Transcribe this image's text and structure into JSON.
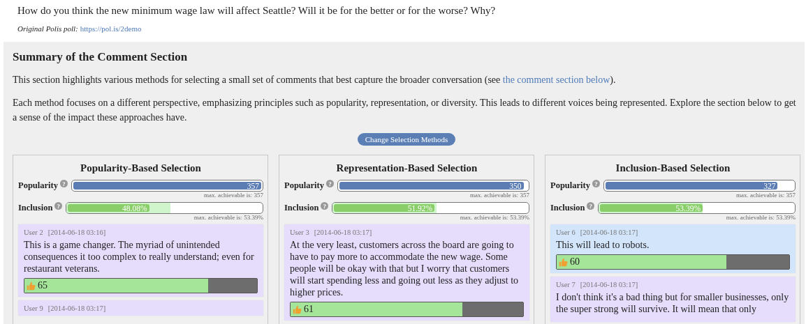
{
  "question": "How do you think the new minimum wage law will affect Seattle? Will it be for the better or for the worse? Why?",
  "poll": {
    "label": "Original Polis poll:",
    "link": "https://pol.is/2demo"
  },
  "summary": {
    "title": "Summary of the Comment Section",
    "intro": "This section highlights various methods for selecting a small set of comments that best capture the broader conversation (see ",
    "intro_link": "the comment section below",
    "intro_end": ").",
    "description": "Each method focuses on a different perspective, emphasizing principles such as popularity, representation, or diversity. This leads to different voices being represented. Explore the section below to get a sense of the impact these approaches have.",
    "button": "Change Selection Methods",
    "methods": [
      {
        "title": "Popularity-Based Selection",
        "metrics": [
          {
            "kind": "popularity",
            "label": "Popularity",
            "help": "?",
            "value": "357",
            "level": 1,
            "max_note": "max. achievable is: 357"
          },
          {
            "kind": "inclusion",
            "label": "Inclusion",
            "help": "?",
            "value": "48.08%",
            "level": 0.42,
            "max": {
              "level": 0.53
            },
            "max_note": "max. achievable is: 53.39%"
          }
        ],
        "comments": [
          {
            "user": "User 2",
            "time": "[2014-06-18 03:16]",
            "text": "This is a game changer. The myriad of unintended consequences it too complex to really understand; even for restaurant veterans.",
            "votes": "65",
            "level": 0.79,
            "color": "#e6dcfc"
          },
          {
            "user": "User 9",
            "time": "[2014-06-18 03:17]",
            "color": "#e6dcfc"
          }
        ]
      },
      {
        "title": "Representation-Based Selection",
        "metrics": [
          {
            "kind": "popularity",
            "label": "Popularity",
            "help": "?",
            "value": "350",
            "level": 0.98,
            "max_note": "max. achievable is: 357"
          },
          {
            "kind": "inclusion",
            "label": "Inclusion",
            "help": "?",
            "value": "51.92%",
            "level": 0.52,
            "max": {
              "level": 0.53
            },
            "max_note": "max. achievable is: 53.39%"
          }
        ],
        "comments": [
          {
            "user": "User 3",
            "time": "[2014-06-18 03:17]",
            "text": "At the very least, customers across the board are going to have to pay more to accommodate the new wage. Some people will be okay with that but I worry that customers will start spending less and going out less as they adjust to higher prices.",
            "votes": "61",
            "level": 0.74,
            "color": "#e6dcfc"
          }
        ]
      },
      {
        "title": "Inclusion-Based Selection",
        "metrics": [
          {
            "kind": "popularity",
            "label": "Popularity",
            "help": "?",
            "value": "327",
            "level": 0.916,
            "max_note": "max. achievable is: 357"
          },
          {
            "kind": "inclusion",
            "label": "Inclusion",
            "help": "?",
            "value": "53.39%",
            "level": 0.53,
            "max": {
              "level": 0.53
            },
            "max_note": "max. achievable is: 53.39%"
          }
        ],
        "comments": [
          {
            "user": "User 6",
            "time": "[2014-06-18 03:17]",
            "text": "This will lead to robots.",
            "votes": "60",
            "level": 0.73,
            "color": "#d2e5fb"
          },
          {
            "user": "User 7",
            "time": "[2014-06-18 03:17]",
            "text": "I don't think it's a bad thing but for smaller businesses, only the super strong will survive. It will mean that only",
            "color": "#e6dcfc"
          }
        ]
      }
    ]
  }
}
